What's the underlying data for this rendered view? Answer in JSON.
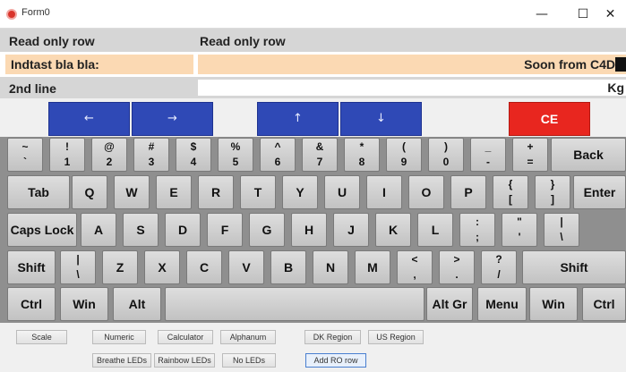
{
  "window": {
    "title": "Form0",
    "minimize": "—",
    "maximize": "☐",
    "close": "✕"
  },
  "display": {
    "ro_label_1": "Read only row",
    "ro_label_2": "Read only row",
    "input_label": "Indtast bla bla:",
    "input_value": "Soon from C4D",
    "second_label": "2nd line",
    "unit": "Kg"
  },
  "nav": {
    "left": "←",
    "right": "→",
    "up": "↑",
    "down": "↓",
    "ce": "CE"
  },
  "keyboard": {
    "rows": [
      [
        [
          "~",
          "`"
        ],
        [
          "!",
          "1"
        ],
        [
          "@",
          "2"
        ],
        [
          "#",
          "3"
        ],
        [
          "$",
          "4"
        ],
        [
          "%",
          "5"
        ],
        [
          "^",
          "6"
        ],
        [
          "&",
          "7"
        ],
        [
          "*",
          "8"
        ],
        [
          "(",
          "9"
        ],
        [
          ")",
          "0"
        ],
        [
          "_",
          "-"
        ],
        [
          "+",
          "="
        ],
        "Back"
      ],
      [
        "Tab",
        "Q",
        "W",
        "E",
        "R",
        "T",
        "Y",
        "U",
        "I",
        "O",
        "P",
        [
          "{",
          "["
        ],
        [
          "}",
          "]"
        ],
        "Enter"
      ],
      [
        "Caps Lock",
        "A",
        "S",
        "D",
        "F",
        "G",
        "H",
        "J",
        "K",
        "L",
        [
          ":",
          ";"
        ],
        [
          "\"",
          "'"
        ],
        [
          "|",
          "\\"
        ]
      ],
      [
        "Shift",
        [
          "|",
          "\\"
        ],
        "Z",
        "X",
        "C",
        "V",
        "B",
        "N",
        "M",
        [
          "<",
          ","
        ],
        [
          ">",
          "."
        ],
        [
          "?",
          "/"
        ],
        "Shift"
      ],
      [
        "Ctrl",
        "Win",
        "Alt",
        "",
        "Alt Gr",
        "Menu",
        "Win",
        "Ctrl"
      ]
    ]
  },
  "options": {
    "row1": [
      "Scale",
      "Numeric",
      "Calculator",
      "Alphanum",
      "DK Region",
      "US Region"
    ],
    "row2": [
      "Breathe LEDs",
      "Rainbow LEDs",
      "No LEDs",
      "Add RO row"
    ]
  }
}
